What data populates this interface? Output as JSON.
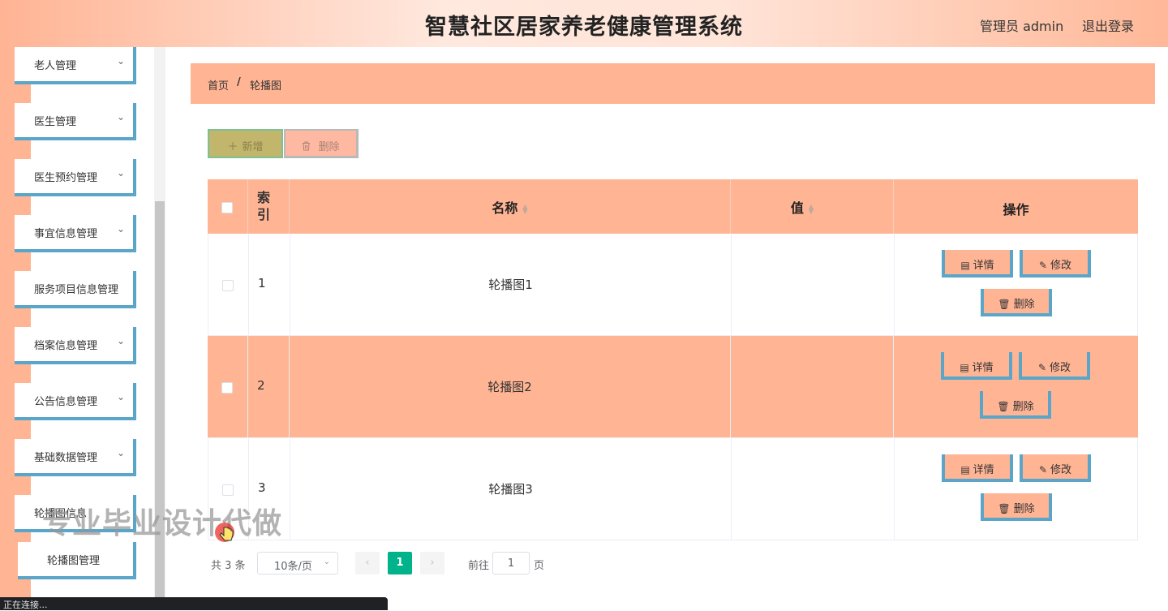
{
  "header": {
    "title": "智慧社区居家养老健康管理系统",
    "user": "管理员 admin",
    "logout": "退出登录"
  },
  "sidebar": {
    "items": [
      {
        "label": "老人管理",
        "has_chevron": true
      },
      {
        "label": "医生管理",
        "has_chevron": true
      },
      {
        "label": "医生预约管理",
        "has_chevron": true
      },
      {
        "label": "事宜信息管理",
        "has_chevron": true
      },
      {
        "label": "服务项目信息管理",
        "has_chevron": false
      },
      {
        "label": "档案信息管理",
        "has_chevron": true
      },
      {
        "label": "公告信息管理",
        "has_chevron": true
      },
      {
        "label": "基础数据管理",
        "has_chevron": true
      },
      {
        "label": "轮播图信息",
        "has_chevron": false
      }
    ],
    "sub_items": [
      {
        "label": "轮播图管理"
      }
    ],
    "chevron_glyph": "⌄"
  },
  "breadcrumb": {
    "home": "首页",
    "separator": "/",
    "current": "轮播图"
  },
  "toolbar": {
    "add_label": "新增",
    "add_icon": "plus-icon",
    "delete_label": "删除",
    "delete_icon": "trash-icon"
  },
  "table": {
    "columns": {
      "index": "索引",
      "name": "名称",
      "value": "值",
      "actions": "操作"
    },
    "rows": [
      {
        "index": "1",
        "name": "轮播图1",
        "value": ""
      },
      {
        "index": "2",
        "name": "轮播图2",
        "value": ""
      },
      {
        "index": "3",
        "name": "轮播图3",
        "value": ""
      }
    ],
    "actions": {
      "detail": "详情",
      "edit": "修改",
      "delete": "删除"
    },
    "colors": {
      "header_bg": "#ffb494",
      "striped_row_bg": "#ffb494",
      "action_border": "#5ba6c8"
    }
  },
  "pagination": {
    "total": "共 3 条",
    "page_size": "10条/页",
    "current_page": "1",
    "goto_label": "前往",
    "goto_value": "1",
    "page_unit": "页",
    "accent": "#00b38a"
  },
  "overlay": {
    "watermark": "专业毕业设计代做",
    "status": "正在连接..."
  }
}
